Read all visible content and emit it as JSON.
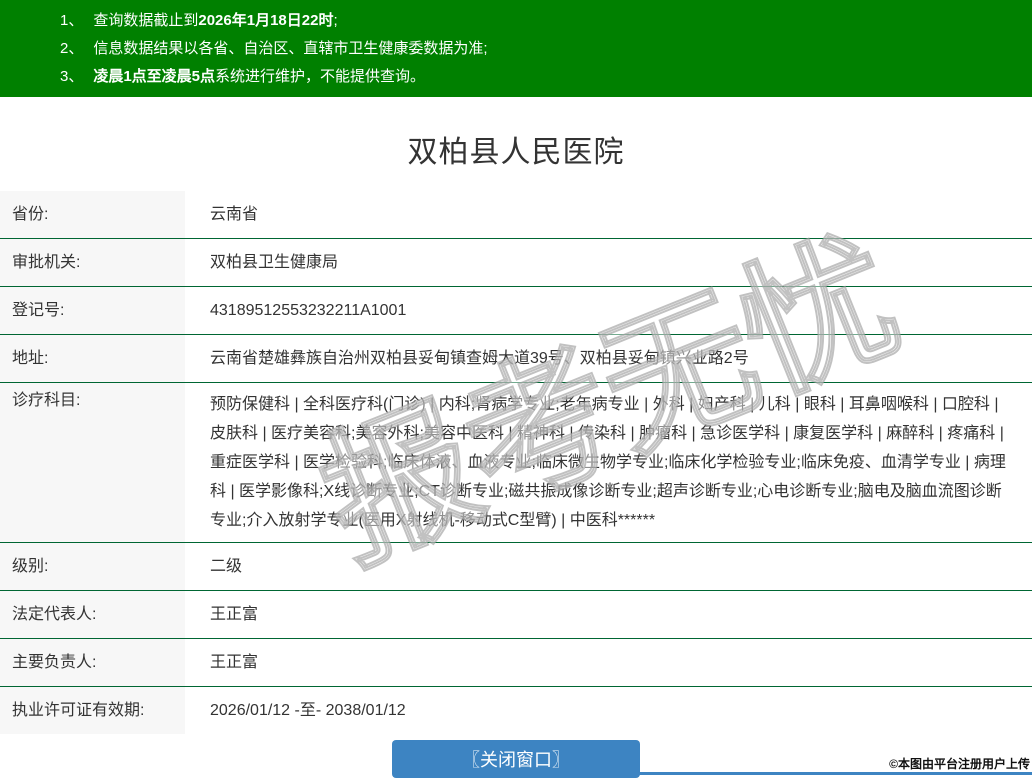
{
  "notices": [
    {
      "num": "1、",
      "pre": "查询数据截止到",
      "bold": "2026年1月18日22时",
      "post": ";"
    },
    {
      "num": "2、",
      "pre": "信息数据结果以各省、自治区、直辖市卫生健康委数据为准;",
      "bold": "",
      "post": ""
    },
    {
      "num": "3、",
      "pre": "",
      "bold": "凌晨1点至凌晨5点",
      "post": "系统进行维护，不能提供查询。"
    }
  ],
  "title": "双柏县人民医院",
  "table": {
    "rows": [
      {
        "label": "省份:",
        "value": "云南省"
      },
      {
        "label": "审批机关:",
        "value": "双柏县卫生健康局"
      },
      {
        "label": "登记号:",
        "value": "43189512553232211A1001"
      },
      {
        "label": "地址:",
        "value": "云南省楚雄彝族自治州双柏县妥甸镇查姆大道39号、双柏县妥甸镇兴业路2号"
      },
      {
        "label": "诊疗科目:",
        "value": "预防保健科 | 全科医疗科(门诊) | 内科;肾病学专业;老年病专业 | 外科 | 妇产科 | 儿科 | 眼科 | 耳鼻咽喉科 | 口腔科 | 皮肤科 | 医疗美容科;美容外科;美容中医科 | 精神科 | 传染科 | 肿瘤科 | 急诊医学科 | 康复医学科 | 麻醉科 | 疼痛科 | 重症医学科 | 医学检验科;临床体液、血液专业;临床微生物学专业;临床化学检验专业;临床免疫、血清学专业 | 病理科 | 医学影像科;X线诊断专业;CT诊断专业;磁共振成像诊断专业;超声诊断专业;心电诊断专业;脑电及脑血流图诊断专业;介入放射学专业(医用X射线机-移动式C型臂) | 中医科******"
      },
      {
        "label": "级别:",
        "value": "二级"
      },
      {
        "label": "法定代表人:",
        "value": "王正富"
      },
      {
        "label": "主要负责人:",
        "value": "王正富"
      },
      {
        "label": "执业许可证有效期:",
        "value": "2026/01/12 -至- 2038/01/12"
      }
    ]
  },
  "close_button_label": "〖关闭窗口〗",
  "watermark_text": "报考无忧",
  "stamp_text": "©本图由平台注册用户上传",
  "colors": {
    "header_green": "#008000",
    "divider_green": "#006633",
    "label_bg": "#f7f7f7",
    "button_blue": "#3d84c2",
    "text": "#333333"
  }
}
